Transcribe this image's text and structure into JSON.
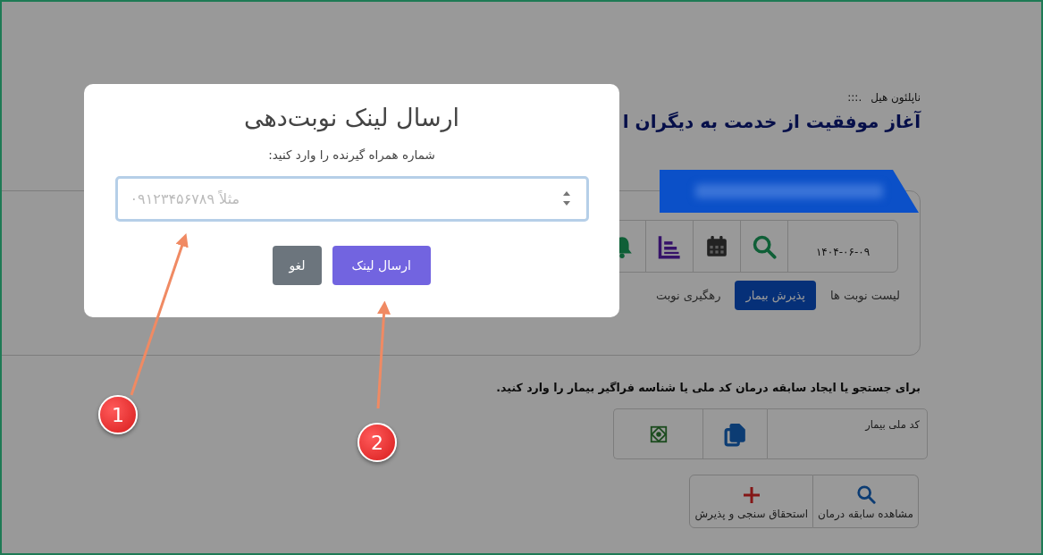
{
  "header": {
    "quote_author": "ناپلئون هیل",
    "separator": ".:::",
    "headline": "آغاز موفقیت از خدمت به دیگران ا"
  },
  "toolbar": {
    "date": "۱۴۰۴-۰۶-۰۹",
    "icons": [
      {
        "kind": "search"
      },
      {
        "kind": "calendar"
      },
      {
        "kind": "chart"
      },
      {
        "kind": "bell"
      }
    ]
  },
  "tabs": [
    {
      "label": "لیست نوبت ها",
      "selected": false
    },
    {
      "label": "پذیرش بیمار",
      "selected": true
    },
    {
      "label": "رهگیری نوبت",
      "selected": false
    }
  ],
  "instruction": "برای جستجو یا ایجاد سابقه درمان کد ملی یا شناسه فراگیر بیمار را وارد کنید.",
  "national_code_field": {
    "placeholder": "کد ملی بیمار"
  },
  "actions": [
    {
      "kind": "search",
      "label": "مشاهده سابقه درمان"
    },
    {
      "kind": "plus",
      "label": "استحقاق سنجی و پذیرش"
    }
  ],
  "dialog": {
    "title": "ارسال لینک نوبت‌دهی",
    "prompt": "شماره همراه گیرنده را وارد کنید:",
    "phone_field": {
      "placeholder": "مثلاً ۰۹۱۲۳۴۵۶۷۸۹"
    },
    "buttons": [
      {
        "kind": "primary",
        "label": "ارسال لینک"
      },
      {
        "kind": "secondary",
        "label": "لغو"
      }
    ]
  },
  "annotations": [
    {
      "label": "1"
    },
    {
      "label": "2"
    }
  ]
}
